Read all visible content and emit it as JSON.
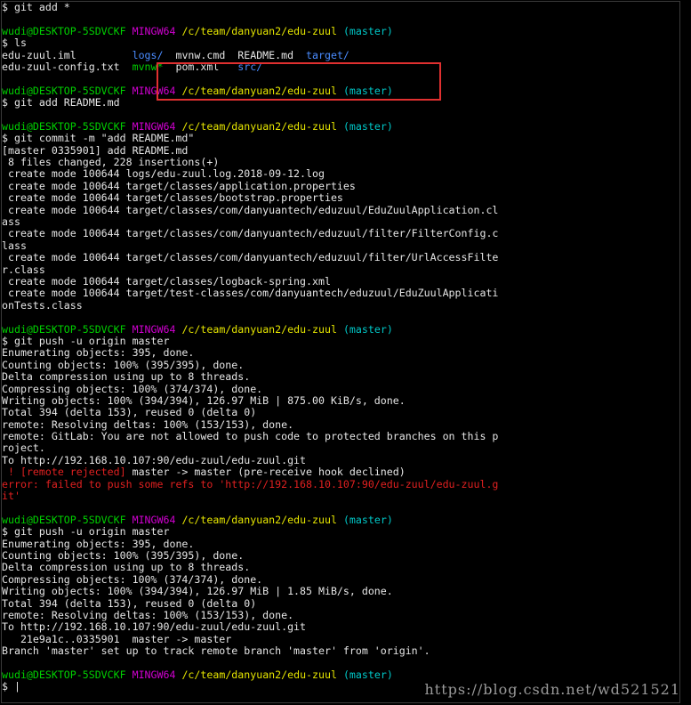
{
  "prompt_user": "wudi@DESKTOP-5SDVCKF",
  "prompt_shell": "MINGW64",
  "prompt_path": "/c/team/danyuan2/edu-zuul",
  "prompt_branch": "(master)",
  "cursor_prompt": "$ |",
  "watermark": "https://blog.csdn.net/wd521521",
  "colors": {
    "user": "#00d000",
    "shell": "#d000d0",
    "path": "#e5e500",
    "branch": "#00c8c8",
    "dir": "#4a8cff",
    "error": "#e02020",
    "highlight_box": "#e03030"
  },
  "lines": [
    {
      "segs": [
        {
          "t": "$ git add *",
          "c": "w"
        }
      ]
    },
    {
      "segs": [
        {
          "t": "",
          "c": "w"
        }
      ]
    },
    {
      "prompt": true
    },
    {
      "segs": [
        {
          "t": "$ ls",
          "c": "w"
        }
      ]
    },
    {
      "segs": [
        {
          "t": "edu-zuul.iml         ",
          "c": "w"
        },
        {
          "t": "logs/",
          "c": "b"
        },
        {
          "t": "  mvnw.cmd  README.md  ",
          "c": "w"
        },
        {
          "t": "target/",
          "c": "b"
        }
      ]
    },
    {
      "segs": [
        {
          "t": "edu-zuul-config.txt  ",
          "c": "w"
        },
        {
          "t": "mvnw*",
          "c": "g"
        },
        {
          "t": "  pom.xml   ",
          "c": "w"
        },
        {
          "t": "src/",
          "c": "b"
        }
      ]
    },
    {
      "segs": [
        {
          "t": "",
          "c": "w"
        }
      ]
    },
    {
      "prompt": true
    },
    {
      "segs": [
        {
          "t": "$ git add README.md",
          "c": "w"
        }
      ]
    },
    {
      "segs": [
        {
          "t": "",
          "c": "w"
        }
      ]
    },
    {
      "prompt": true
    },
    {
      "segs": [
        {
          "t": "$ git commit -m \"add README.md\"",
          "c": "w"
        }
      ]
    },
    {
      "segs": [
        {
          "t": "[master 0335901] add README.md",
          "c": "w"
        }
      ]
    },
    {
      "segs": [
        {
          "t": " 8 files changed, 228 insertions(+)",
          "c": "w"
        }
      ]
    },
    {
      "segs": [
        {
          "t": " create mode 100644 logs/edu-zuul.log.2018-09-12.log",
          "c": "w"
        }
      ]
    },
    {
      "segs": [
        {
          "t": " create mode 100644 target/classes/application.properties",
          "c": "w"
        }
      ]
    },
    {
      "segs": [
        {
          "t": " create mode 100644 target/classes/bootstrap.properties",
          "c": "w"
        }
      ]
    },
    {
      "segs": [
        {
          "t": " create mode 100644 target/classes/com/danyuantech/eduzuul/EduZuulApplication.cl",
          "c": "w"
        }
      ]
    },
    {
      "segs": [
        {
          "t": "ass",
          "c": "w"
        }
      ]
    },
    {
      "segs": [
        {
          "t": " create mode 100644 target/classes/com/danyuantech/eduzuul/filter/FilterConfig.c",
          "c": "w"
        }
      ]
    },
    {
      "segs": [
        {
          "t": "lass",
          "c": "w"
        }
      ]
    },
    {
      "segs": [
        {
          "t": " create mode 100644 target/classes/com/danyuantech/eduzuul/filter/UrlAccessFilte",
          "c": "w"
        }
      ]
    },
    {
      "segs": [
        {
          "t": "r.class",
          "c": "w"
        }
      ]
    },
    {
      "segs": [
        {
          "t": " create mode 100644 target/classes/logback-spring.xml",
          "c": "w"
        }
      ]
    },
    {
      "segs": [
        {
          "t": " create mode 100644 target/test-classes/com/danyuantech/eduzuul/EduZuulApplicati",
          "c": "w"
        }
      ]
    },
    {
      "segs": [
        {
          "t": "onTests.class",
          "c": "w"
        }
      ]
    },
    {
      "segs": [
        {
          "t": "",
          "c": "w"
        }
      ]
    },
    {
      "prompt": true
    },
    {
      "segs": [
        {
          "t": "$ git push -u origin master",
          "c": "w"
        }
      ]
    },
    {
      "segs": [
        {
          "t": "Enumerating objects: 395, done.",
          "c": "w"
        }
      ]
    },
    {
      "segs": [
        {
          "t": "Counting objects: 100% (395/395), done.",
          "c": "w"
        }
      ]
    },
    {
      "segs": [
        {
          "t": "Delta compression using up to 8 threads.",
          "c": "w"
        }
      ]
    },
    {
      "segs": [
        {
          "t": "Compressing objects: 100% (374/374), done.",
          "c": "w"
        }
      ]
    },
    {
      "segs": [
        {
          "t": "Writing objects: 100% (394/394), 126.97 MiB | 875.00 KiB/s, done.",
          "c": "w"
        }
      ]
    },
    {
      "segs": [
        {
          "t": "Total 394 (delta 153), reused 0 (delta 0)",
          "c": "w"
        }
      ]
    },
    {
      "segs": [
        {
          "t": "remote: Resolving deltas: 100% (153/153), done.",
          "c": "w"
        }
      ]
    },
    {
      "segs": [
        {
          "t": "remote: GitLab: You are not allowed to push code to protected branches on this p",
          "c": "w"
        }
      ]
    },
    {
      "segs": [
        {
          "t": "roject.",
          "c": "w"
        }
      ]
    },
    {
      "segs": [
        {
          "t": "To http://192.168.10.107:90/edu-zuul/edu-zuul.git",
          "c": "w"
        }
      ]
    },
    {
      "segs": [
        {
          "t": " ! [remote rejected] ",
          "c": "r"
        },
        {
          "t": "master -> master (pre-receive hook declined)",
          "c": "w"
        }
      ]
    },
    {
      "segs": [
        {
          "t": "error: failed to push some refs to 'http://192.168.10.107:90/edu-zuul/edu-zuul.g",
          "c": "r"
        }
      ]
    },
    {
      "segs": [
        {
          "t": "it'",
          "c": "r"
        }
      ]
    },
    {
      "segs": [
        {
          "t": "",
          "c": "w"
        }
      ]
    },
    {
      "prompt": true
    },
    {
      "segs": [
        {
          "t": "$ git push -u origin master",
          "c": "w"
        }
      ]
    },
    {
      "segs": [
        {
          "t": "Enumerating objects: 395, done.",
          "c": "w"
        }
      ]
    },
    {
      "segs": [
        {
          "t": "Counting objects: 100% (395/395), done.",
          "c": "w"
        }
      ]
    },
    {
      "segs": [
        {
          "t": "Delta compression using up to 8 threads.",
          "c": "w"
        }
      ]
    },
    {
      "segs": [
        {
          "t": "Compressing objects: 100% (374/374), done.",
          "c": "w"
        }
      ]
    },
    {
      "segs": [
        {
          "t": "Writing objects: 100% (394/394), 126.97 MiB | 1.85 MiB/s, done.",
          "c": "w"
        }
      ]
    },
    {
      "segs": [
        {
          "t": "Total 394 (delta 153), reused 0 (delta 0)",
          "c": "w"
        }
      ]
    },
    {
      "segs": [
        {
          "t": "remote: Resolving deltas: 100% (153/153), done.",
          "c": "w"
        }
      ]
    },
    {
      "segs": [
        {
          "t": "To http://192.168.10.107:90/edu-zuul/edu-zuul.git",
          "c": "w"
        }
      ]
    },
    {
      "segs": [
        {
          "t": "   21e9a1c..0335901  master -> master",
          "c": "w"
        }
      ]
    },
    {
      "segs": [
        {
          "t": "Branch 'master' set up to track remote branch 'master' from 'origin'.",
          "c": "w"
        }
      ]
    },
    {
      "segs": [
        {
          "t": "",
          "c": "w"
        }
      ]
    },
    {
      "prompt": true
    },
    {
      "cursor": true
    }
  ]
}
